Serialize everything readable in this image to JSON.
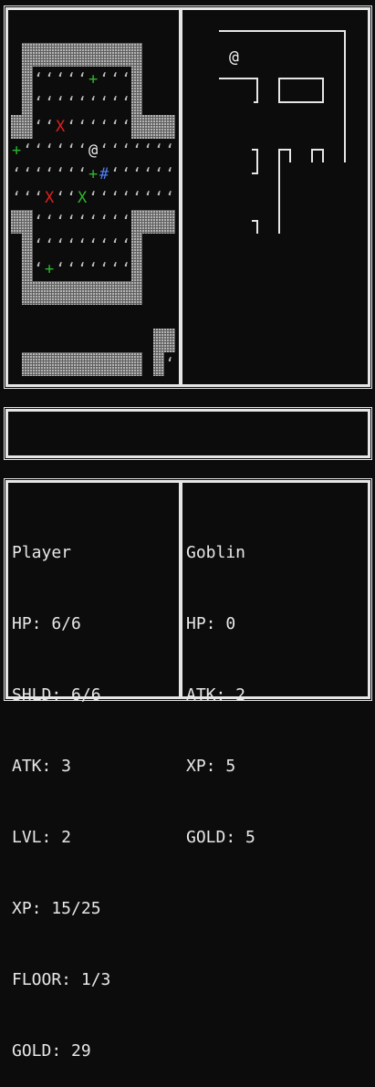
{
  "map": {
    "wall_color": "#a0a0a0",
    "floor_color": "#bdbdbd",
    "floor_glyph": "ʻ",
    "player_glyph": "@",
    "enemy_glyph": "X",
    "item_glyph": "+",
    "special_glyph": "#",
    "colors": {
      "red": "#e02020",
      "green": "#2db82d",
      "blue": "#4f7df0",
      "white": "#f0f0f0"
    }
  },
  "minimap": {
    "player_glyph": "@"
  },
  "message_log": {
    "text": ""
  },
  "player_panel": {
    "name": "Player",
    "hp": "HP: 6/6",
    "shield": "SHLD: 6/6",
    "atk": "ATK: 3",
    "lvl": "LVL: 2",
    "xp": "XP: 15/25",
    "floor": "FLOOR: 1/3",
    "gold": "GOLD: 29"
  },
  "enemy_panel": {
    "name": "Goblin",
    "hp": "HP: 0",
    "atk": "ATK: 2",
    "xp": "XP: 5",
    "gold": "GOLD: 5"
  }
}
